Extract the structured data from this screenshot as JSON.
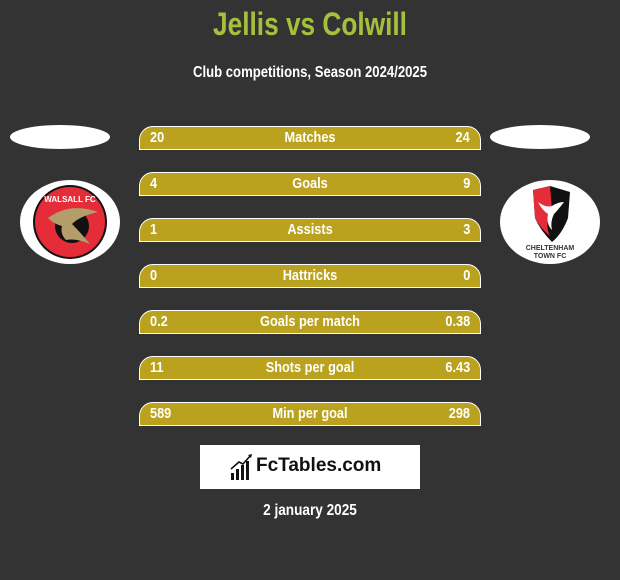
{
  "header": {
    "title": "Jellis vs Colwill",
    "subtitle": "Club competitions, Season 2024/2025"
  },
  "teams": {
    "left": {
      "name": "Walsall FC",
      "logo_text": "WALSALL FC"
    },
    "right": {
      "name": "Cheltenham Town FC",
      "logo_text_line1": "CHELTENHAM",
      "logo_text_line2": "TOWN FC"
    }
  },
  "stats": [
    {
      "label": "Matches",
      "left": "20",
      "right": "24"
    },
    {
      "label": "Goals",
      "left": "4",
      "right": "9"
    },
    {
      "label": "Assists",
      "left": "1",
      "right": "3"
    },
    {
      "label": "Hattricks",
      "left": "0",
      "right": "0"
    },
    {
      "label": "Goals per match",
      "left": "0.2",
      "right": "0.38"
    },
    {
      "label": "Shots per goal",
      "left": "11",
      "right": "6.43"
    },
    {
      "label": "Min per goal",
      "left": "589",
      "right": "298"
    }
  ],
  "brand": {
    "name": "FcTables.com"
  },
  "date": "2 january 2025",
  "colors": {
    "background": "#333333",
    "title": "#a4c13e",
    "bar": "#baa21e"
  }
}
